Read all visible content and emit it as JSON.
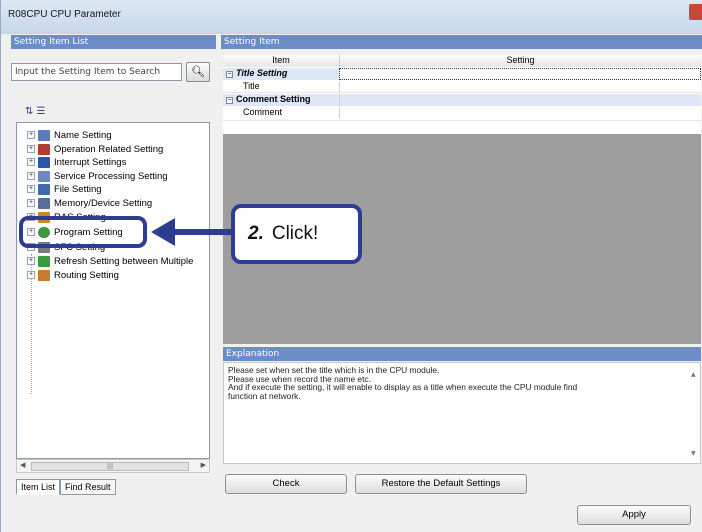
{
  "window": {
    "title": "R08CPU CPU Parameter"
  },
  "left_panel": {
    "header": "Setting Item List",
    "search_placeholder": "Input the Setting Item to Search",
    "search_icon": "binoculars-icon",
    "tree_items": [
      {
        "label": "Name Setting",
        "icon": "name-icon",
        "color": "#5b7bb7"
      },
      {
        "label": "Operation Related Setting",
        "icon": "operation-icon",
        "color": "#b33a2e"
      },
      {
        "label": "Interrupt Settings",
        "icon": "interrupt-icon",
        "color": "#2d55a6"
      },
      {
        "label": "Service Processing Setting",
        "icon": "service-icon",
        "color": "#6c87c2"
      },
      {
        "label": "File Setting",
        "icon": "file-icon",
        "color": "#4169b0"
      },
      {
        "label": "Memory/Device Setting",
        "icon": "memory-icon",
        "color": "#586e96"
      },
      {
        "label": "RAS Setting",
        "icon": "ras-icon",
        "color": "#c98b2a"
      },
      {
        "label": "Program Setting",
        "icon": "program-icon",
        "color": "#3e9a3e"
      },
      {
        "label": "SFC Setting",
        "icon": "sfc-icon",
        "color": "#7a7a7a"
      },
      {
        "label": "Refresh Setting between Multiple",
        "icon": "refresh-icon",
        "color": "#3e9a3e"
      },
      {
        "label": "Routing Setting",
        "icon": "routing-icon",
        "color": "#c47b2a"
      }
    ],
    "tabs": [
      "Item List",
      "Find Result"
    ]
  },
  "right_panel": {
    "header": "Setting Item",
    "table": {
      "col_item": "Item",
      "col_setting": "Setting",
      "rows": [
        {
          "label": "Title Setting",
          "type": "group"
        },
        {
          "label": "Title",
          "type": "child"
        },
        {
          "label": "Comment Setting",
          "type": "group"
        },
        {
          "label": "Comment",
          "type": "child"
        }
      ]
    },
    "explanation_header": "Explanation",
    "explanation_lines": [
      "Please set when set the title which is in the CPU module.",
      "Please use when record the name etc.",
      "And if execute the setting, it will enable to display as a title when execute the CPU module find",
      "function at network."
    ],
    "check_button": "Check",
    "restore_button": "Restore the Default Settings"
  },
  "apply_button": "Apply",
  "callout": {
    "step": "2.",
    "text": "Click!"
  },
  "colors": {
    "pane_header": "#6b8cc4",
    "callout_border": "#2e3d91",
    "grid_grey": "#9e9e9e"
  }
}
